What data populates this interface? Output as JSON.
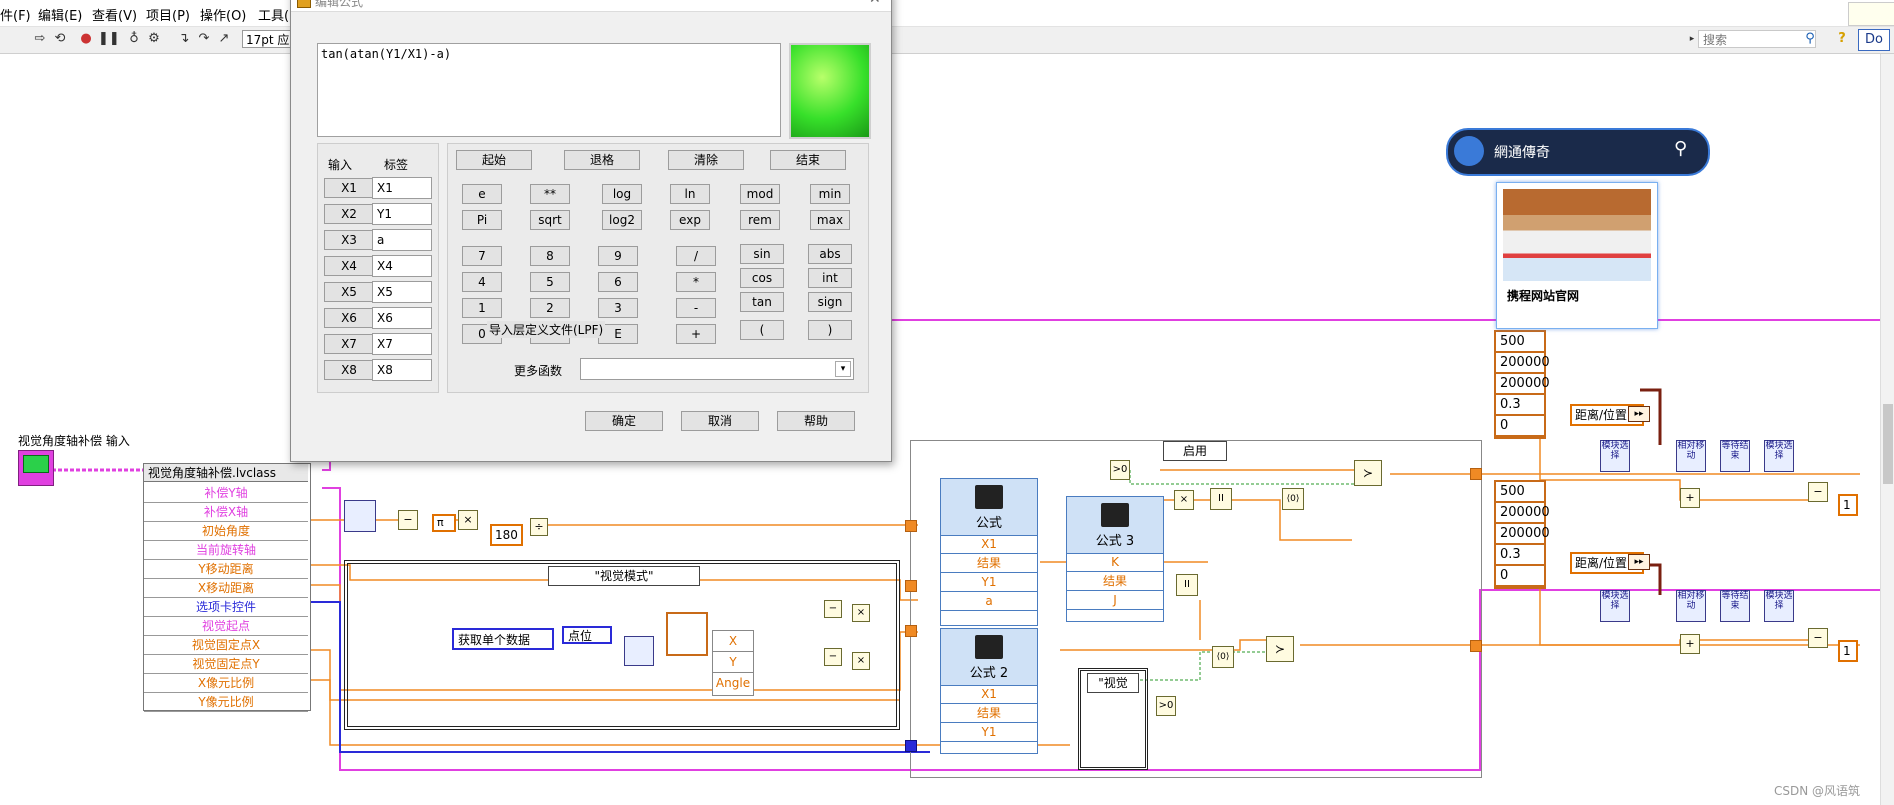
{
  "menu": [
    "件(F)",
    "编辑(E)",
    "查看(V)",
    "项目(P)",
    "操作(O)",
    "工具("
  ],
  "toolbar": {
    "font_value": "17pt 应",
    "search_placeholder": "搜索",
    "do_label": "Do"
  },
  "dialog": {
    "title": "编辑公式",
    "formula": "tan(atan(Y1/X1)-a)",
    "input_header": "输入",
    "label_header": "标签",
    "inputs": [
      {
        "name": "X1",
        "label": "X1"
      },
      {
        "name": "X2",
        "label": "Y1"
      },
      {
        "name": "X3",
        "label": "a"
      },
      {
        "name": "X4",
        "label": "X4"
      },
      {
        "name": "X5",
        "label": "X5"
      },
      {
        "name": "X6",
        "label": "X6"
      },
      {
        "name": "X7",
        "label": "X7"
      },
      {
        "name": "X8",
        "label": "X8"
      }
    ],
    "top_buttons": [
      "起始",
      "退格",
      "清除",
      "结束"
    ],
    "func_row1": [
      "e",
      "**",
      "log",
      "ln",
      "mod",
      "min"
    ],
    "func_row2": [
      "Pi",
      "sqrt",
      "log2",
      "exp",
      "rem",
      "max"
    ],
    "digits": {
      "r1": [
        "7",
        "8",
        "9",
        "/"
      ],
      "r2": [
        "4",
        "5",
        "6",
        "*"
      ],
      "r3": [
        "1",
        "2",
        "3",
        "-"
      ],
      "r4": [
        "0",
        ".",
        "E",
        "+"
      ]
    },
    "trig": [
      "sin",
      "cos",
      "tan"
    ],
    "misc": [
      "abs",
      "int",
      "sign"
    ],
    "parens": [
      "(",
      ")"
    ],
    "import_label": "导入层定义文件(LPF)",
    "more_functions": "更多函数",
    "ok": "确定",
    "cancel": "取消",
    "help": "帮助"
  },
  "diagram": {
    "control_label": "视觉角度轴补偿 输入",
    "unbundle_title": "视觉角度轴补偿.lvclass",
    "unbundle_rows": [
      {
        "text": "补偿Y轴",
        "color": "#e040e0"
      },
      {
        "text": "补偿X轴",
        "color": "#e040e0"
      },
      {
        "text": "初始角度",
        "color": "#e07000"
      },
      {
        "text": "当前旋转轴",
        "color": "#e040e0"
      },
      {
        "text": "Y移动距离",
        "color": "#e07000"
      },
      {
        "text": "X移动距离",
        "color": "#e07000"
      },
      {
        "text": "选项卡控件",
        "color": "#2a2ad8"
      },
      {
        "text": "视觉起点",
        "color": "#e040e0"
      },
      {
        "text": "视觉固定点X",
        "color": "#e07000"
      },
      {
        "text": "视觉固定点Y",
        "color": "#e07000"
      },
      {
        "text": "X像元比例",
        "color": "#e07000"
      },
      {
        "text": "Y像元比例",
        "color": "#e07000"
      }
    ],
    "case_vision_mode": "\"视觉模式\"",
    "get_single_data": "获取单个数据",
    "point_label": "点位",
    "pi_label": "π",
    "const_180": "180",
    "xya": [
      "X",
      "Y",
      "Angle"
    ],
    "enable_case": "启用",
    "vision_case": "\"视觉",
    "formula1": {
      "title": "公式",
      "rows": [
        "X1",
        "结果",
        "Y1",
        "a"
      ]
    },
    "formula2": {
      "title": "公式 2",
      "rows": [
        "X1",
        "结果",
        "Y1"
      ]
    },
    "formula3": {
      "title": "公式 3",
      "rows": [
        "K",
        "结果",
        "J"
      ]
    },
    "const_stack1": [
      "500",
      "200000",
      "200000",
      "0.3",
      "0"
    ],
    "const_stack2": [
      "500",
      "200000",
      "200000",
      "0.3",
      "0"
    ],
    "distance_pos": "距离/位置",
    "const_one": "1",
    "subvi_a": "模块选择",
    "subvi_b": "相对移动",
    "subvi_c": "等待结束"
  },
  "overlay": {
    "search_brand": "網通傳奇",
    "card_title": "携程网站官网"
  },
  "watermark": "CSDN @风语筑"
}
